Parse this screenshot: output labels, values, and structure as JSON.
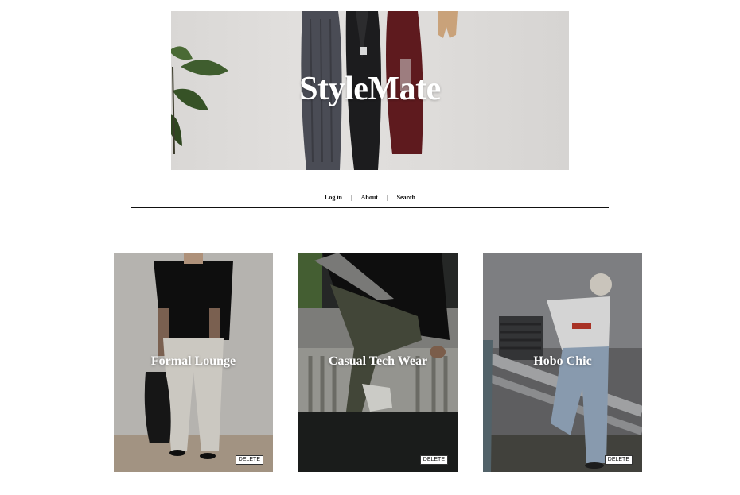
{
  "brand": {
    "title": "StyleMate"
  },
  "nav": {
    "items": [
      {
        "label": "Log in"
      },
      {
        "label": "About"
      },
      {
        "label": "Search"
      }
    ],
    "separator": "|"
  },
  "cards": [
    {
      "title": "Formal Lounge",
      "delete_label": "DELETE"
    },
    {
      "title": "Casual Tech Wear",
      "delete_label": "DELETE"
    },
    {
      "title": "Hobo Chic",
      "delete_label": "DELETE"
    }
  ],
  "colors": {
    "text": "#111111",
    "background": "#ffffff",
    "overlay_text": "#ffffff"
  }
}
